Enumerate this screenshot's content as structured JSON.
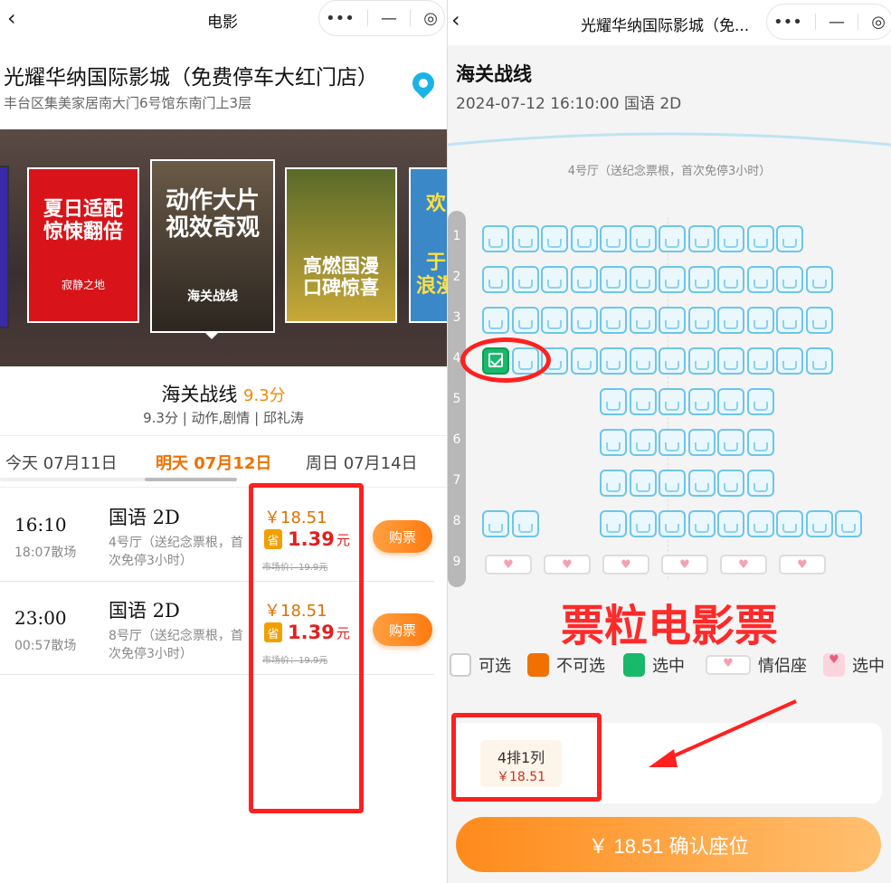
{
  "left": {
    "nav": {
      "title": "电影"
    },
    "cinema": {
      "name": "光耀华纳国际影城（免费停车大红门店）",
      "address": "丰台区集美家居南大门6号馆东南门上3层"
    },
    "posters": [
      {
        "line1": "夏日适配",
        "line2": "惊悚翻倍",
        "sub": "寂静之地"
      },
      {
        "line1": "动作大片",
        "line2": "视效奇观",
        "sub": "海关战线"
      },
      {
        "line1": "高燃国漫",
        "line2": "口碑惊喜",
        "sub": ""
      },
      {
        "line1": "欢",
        "line2": "于",
        "sub": "浪漫"
      }
    ],
    "movie": {
      "title": "海关战线",
      "score": "9.3分",
      "meta": "9.3分 | 动作,剧情 | 邱礼涛"
    },
    "tabs": [
      {
        "label": "今天 07月11日"
      },
      {
        "label": "明天 07月12日"
      },
      {
        "label": "周日 07月14日"
      }
    ],
    "showtimes": [
      {
        "time": "16:10",
        "end": "18:07散场",
        "lang": "国语 2D",
        "hall": "4号厅（送纪念票根，首次免停3小时）",
        "price": "￥18.51",
        "save_tag": "省",
        "save_amt": "1.39",
        "save_unit": "元",
        "market": "市场价：19.9元",
        "buy": "购票"
      },
      {
        "time": "23:00",
        "end": "00:57散场",
        "lang": "国语 2D",
        "hall": "8号厅（送纪念票根，首次免停3小时）",
        "price": "￥18.51",
        "save_tag": "省",
        "save_amt": "1.39",
        "save_unit": "元",
        "market": "市场价：19.9元",
        "buy": "购票"
      }
    ]
  },
  "right": {
    "nav": {
      "title": "光耀华纳国际影城（免..."
    },
    "movie_title": "海关战线",
    "session": "2024-07-12 16:10:00 国语 2D",
    "hall_label": "4号厅（送纪念票根，首次免停3小时）",
    "rows": [
      "1",
      "2",
      "3",
      "4",
      "5",
      "6",
      "7",
      "8",
      "9"
    ],
    "watermark": "票粒电影票",
    "legend": [
      {
        "label": "可选"
      },
      {
        "label": "不可选"
      },
      {
        "label": "选中"
      },
      {
        "label": "情侣座"
      },
      {
        "label": "选中"
      }
    ],
    "selected_seat": {
      "label": "4排1列",
      "price": "￥18.51"
    },
    "confirm": "￥ 18.51 确认座位"
  },
  "colors": {
    "accent": "#f07000",
    "red_annotation": "#ff2020",
    "seat_border": "#6cc6ea",
    "selected": "#18b96a"
  }
}
